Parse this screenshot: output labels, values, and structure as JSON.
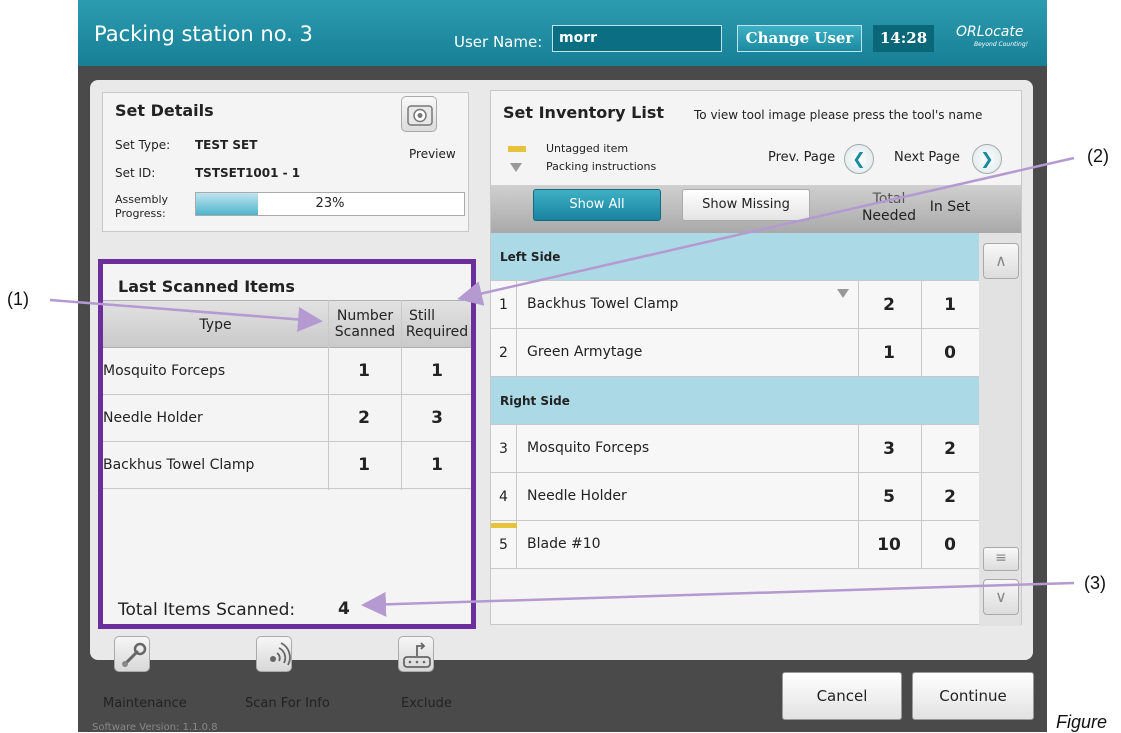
{
  "header": {
    "title": "Packing station no. 3",
    "user_label": "User Name:",
    "user_value": "morr",
    "change_user_label": "Change User",
    "time": "14:28",
    "logo_main": "ORLocate",
    "logo_sub": "Beyond Counting!"
  },
  "set_details": {
    "title": "Set Details",
    "set_type_label": "Set Type:",
    "set_type_value": "TEST SET",
    "set_id_label": "Set ID:",
    "set_id_value": "TSTSET1001 - 1",
    "assembly_label_1": "Assembly",
    "assembly_label_2": "Progress:",
    "progress_text": "23%",
    "progress_fraction": 0.23,
    "preview_label": "Preview"
  },
  "last_scanned": {
    "title": "Last Scanned Items",
    "columns": {
      "type": "Type",
      "scanned_1": "Number",
      "scanned_2": "Scanned",
      "required_1": "Still",
      "required_2": "Required"
    },
    "rows": [
      {
        "type": "Mosquito Forceps",
        "scanned": "1",
        "required": "1"
      },
      {
        "type": "Needle Holder",
        "scanned": "2",
        "required": "3"
      },
      {
        "type": "Backhus Towel Clamp",
        "scanned": "1",
        "required": "1"
      }
    ],
    "total_label": "Total Items Scanned:",
    "total_value": "4"
  },
  "bottom_tools": {
    "maintenance": "Maintenance",
    "scan_for_info": "Scan For Info",
    "exclude": "Exclude"
  },
  "version": "Software Version: 1.1.0.8",
  "inventory": {
    "title": "Set Inventory List",
    "hint": "To view tool image please press the tool's name",
    "legend_untagged": "Untagged item",
    "legend_instructions": "Packing instructions",
    "prev_page": "Prev. Page",
    "next_page": "Next Page",
    "show_all": "Show All",
    "show_missing": "Show Missing",
    "col_total_1": "Total",
    "col_total_2": "Needed",
    "col_in_set": "In Set",
    "section_left": "Left Side",
    "section_right": "Right Side",
    "rows": [
      {
        "idx": "1",
        "name": "Backhus Towel Clamp",
        "total": "2",
        "in_set": "1"
      },
      {
        "idx": "2",
        "name": "Green Armytage",
        "total": "1",
        "in_set": "0"
      },
      {
        "idx": "3",
        "name": "Mosquito Forceps",
        "total": "3",
        "in_set": "2"
      },
      {
        "idx": "4",
        "name": "Needle Holder",
        "total": "5",
        "in_set": "2"
      },
      {
        "idx": "5",
        "name": "Blade #10",
        "total": "10",
        "in_set": "0"
      }
    ]
  },
  "actions": {
    "cancel": "Cancel",
    "continue": "Continue"
  },
  "annotations": {
    "callout_1": "(1)",
    "callout_2": "(2)",
    "callout_3": "(3)",
    "figure_text": "Figure",
    "arrow_color": "#b49ad0"
  },
  "colors": {
    "header": "#1e8ea4",
    "highlight_border": "#6a2f9a",
    "section_row": "#acd9e6",
    "untagged": "#e6c33a"
  }
}
